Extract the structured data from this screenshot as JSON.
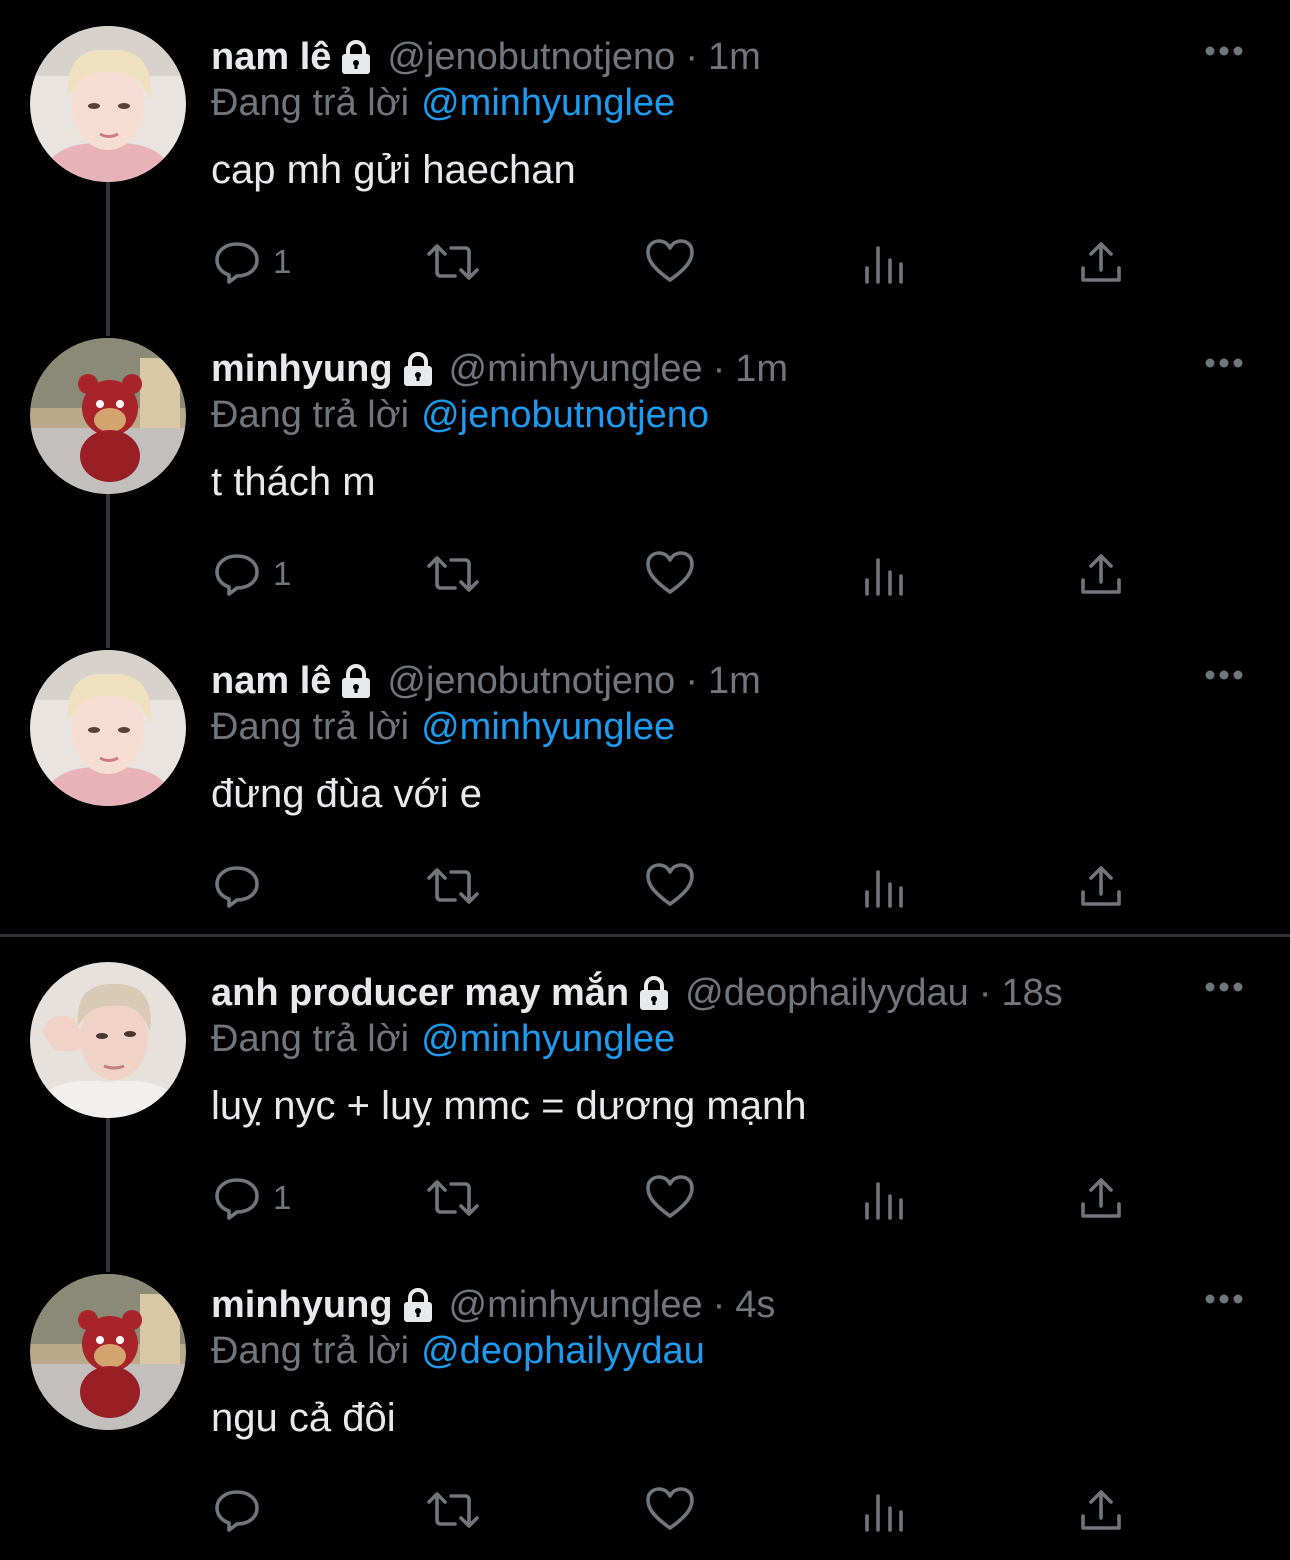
{
  "reply_prefix": "Đang trả lời",
  "colors": {
    "background": "#000000",
    "text": "#e7e9ea",
    "secondary": "#71767b",
    "link": "#1d9bf0",
    "thread_line": "#333639"
  },
  "tweets": [
    {
      "name": "nam lê",
      "handle": "@jenobutnotjeno",
      "time": "1m",
      "reply_to": "@minhyunglee",
      "text": "cap mh gửi haechan",
      "reply_count": "1",
      "avatar": "blonde-person-avatar"
    },
    {
      "name": "minhyung",
      "handle": "@minhyunglee",
      "time": "1m",
      "reply_to": "@jenobutnotjeno",
      "text": "t thách m",
      "reply_count": "1",
      "avatar": "plush-bear-avatar"
    },
    {
      "name": "nam lê",
      "handle": "@jenobutnotjeno",
      "time": "1m",
      "reply_to": "@minhyunglee",
      "text": "đừng đùa với e",
      "reply_count": "",
      "avatar": "blonde-person-avatar"
    },
    {
      "name": "anh producer may mắn",
      "handle": "@deophailyydau",
      "time": "18s",
      "reply_to": "@minhyunglee",
      "text": "luỵ nyc + luỵ mmc = dương mạnh",
      "reply_count": "1",
      "avatar": "person-waving-avatar"
    },
    {
      "name": "minhyung",
      "handle": "@minhyunglee",
      "time": "4s",
      "reply_to": "@deophailyydau",
      "text": "ngu cả đôi",
      "reply_count": "",
      "avatar": "plush-bear-avatar"
    }
  ]
}
